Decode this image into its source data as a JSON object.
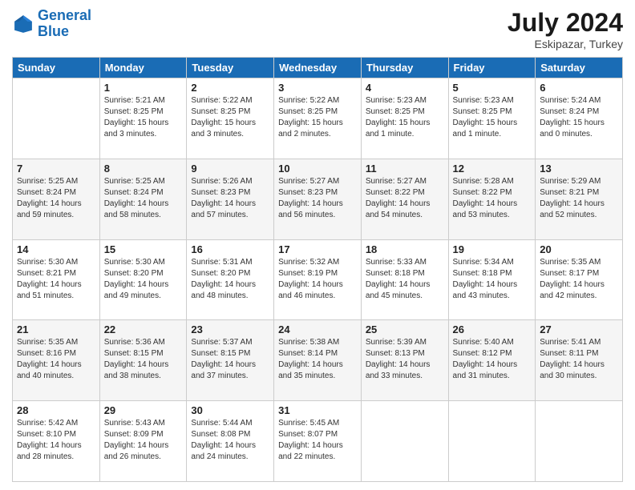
{
  "header": {
    "logo_line1": "General",
    "logo_line2": "Blue",
    "month": "July 2024",
    "location": "Eskipazar, Turkey"
  },
  "days": [
    "Sunday",
    "Monday",
    "Tuesday",
    "Wednesday",
    "Thursday",
    "Friday",
    "Saturday"
  ],
  "weeks": [
    [
      {
        "date": "",
        "sunrise": "",
        "sunset": "",
        "daylight": ""
      },
      {
        "date": "1",
        "sunrise": "Sunrise: 5:21 AM",
        "sunset": "Sunset: 8:25 PM",
        "daylight": "Daylight: 15 hours and 3 minutes."
      },
      {
        "date": "2",
        "sunrise": "Sunrise: 5:22 AM",
        "sunset": "Sunset: 8:25 PM",
        "daylight": "Daylight: 15 hours and 3 minutes."
      },
      {
        "date": "3",
        "sunrise": "Sunrise: 5:22 AM",
        "sunset": "Sunset: 8:25 PM",
        "daylight": "Daylight: 15 hours and 2 minutes."
      },
      {
        "date": "4",
        "sunrise": "Sunrise: 5:23 AM",
        "sunset": "Sunset: 8:25 PM",
        "daylight": "Daylight: 15 hours and 1 minute."
      },
      {
        "date": "5",
        "sunrise": "Sunrise: 5:23 AM",
        "sunset": "Sunset: 8:25 PM",
        "daylight": "Daylight: 15 hours and 1 minute."
      },
      {
        "date": "6",
        "sunrise": "Sunrise: 5:24 AM",
        "sunset": "Sunset: 8:24 PM",
        "daylight": "Daylight: 15 hours and 0 minutes."
      }
    ],
    [
      {
        "date": "7",
        "sunrise": "Sunrise: 5:25 AM",
        "sunset": "Sunset: 8:24 PM",
        "daylight": "Daylight: 14 hours and 59 minutes."
      },
      {
        "date": "8",
        "sunrise": "Sunrise: 5:25 AM",
        "sunset": "Sunset: 8:24 PM",
        "daylight": "Daylight: 14 hours and 58 minutes."
      },
      {
        "date": "9",
        "sunrise": "Sunrise: 5:26 AM",
        "sunset": "Sunset: 8:23 PM",
        "daylight": "Daylight: 14 hours and 57 minutes."
      },
      {
        "date": "10",
        "sunrise": "Sunrise: 5:27 AM",
        "sunset": "Sunset: 8:23 PM",
        "daylight": "Daylight: 14 hours and 56 minutes."
      },
      {
        "date": "11",
        "sunrise": "Sunrise: 5:27 AM",
        "sunset": "Sunset: 8:22 PM",
        "daylight": "Daylight: 14 hours and 54 minutes."
      },
      {
        "date": "12",
        "sunrise": "Sunrise: 5:28 AM",
        "sunset": "Sunset: 8:22 PM",
        "daylight": "Daylight: 14 hours and 53 minutes."
      },
      {
        "date": "13",
        "sunrise": "Sunrise: 5:29 AM",
        "sunset": "Sunset: 8:21 PM",
        "daylight": "Daylight: 14 hours and 52 minutes."
      }
    ],
    [
      {
        "date": "14",
        "sunrise": "Sunrise: 5:30 AM",
        "sunset": "Sunset: 8:21 PM",
        "daylight": "Daylight: 14 hours and 51 minutes."
      },
      {
        "date": "15",
        "sunrise": "Sunrise: 5:30 AM",
        "sunset": "Sunset: 8:20 PM",
        "daylight": "Daylight: 14 hours and 49 minutes."
      },
      {
        "date": "16",
        "sunrise": "Sunrise: 5:31 AM",
        "sunset": "Sunset: 8:20 PM",
        "daylight": "Daylight: 14 hours and 48 minutes."
      },
      {
        "date": "17",
        "sunrise": "Sunrise: 5:32 AM",
        "sunset": "Sunset: 8:19 PM",
        "daylight": "Daylight: 14 hours and 46 minutes."
      },
      {
        "date": "18",
        "sunrise": "Sunrise: 5:33 AM",
        "sunset": "Sunset: 8:18 PM",
        "daylight": "Daylight: 14 hours and 45 minutes."
      },
      {
        "date": "19",
        "sunrise": "Sunrise: 5:34 AM",
        "sunset": "Sunset: 8:18 PM",
        "daylight": "Daylight: 14 hours and 43 minutes."
      },
      {
        "date": "20",
        "sunrise": "Sunrise: 5:35 AM",
        "sunset": "Sunset: 8:17 PM",
        "daylight": "Daylight: 14 hours and 42 minutes."
      }
    ],
    [
      {
        "date": "21",
        "sunrise": "Sunrise: 5:35 AM",
        "sunset": "Sunset: 8:16 PM",
        "daylight": "Daylight: 14 hours and 40 minutes."
      },
      {
        "date": "22",
        "sunrise": "Sunrise: 5:36 AM",
        "sunset": "Sunset: 8:15 PM",
        "daylight": "Daylight: 14 hours and 38 minutes."
      },
      {
        "date": "23",
        "sunrise": "Sunrise: 5:37 AM",
        "sunset": "Sunset: 8:15 PM",
        "daylight": "Daylight: 14 hours and 37 minutes."
      },
      {
        "date": "24",
        "sunrise": "Sunrise: 5:38 AM",
        "sunset": "Sunset: 8:14 PM",
        "daylight": "Daylight: 14 hours and 35 minutes."
      },
      {
        "date": "25",
        "sunrise": "Sunrise: 5:39 AM",
        "sunset": "Sunset: 8:13 PM",
        "daylight": "Daylight: 14 hours and 33 minutes."
      },
      {
        "date": "26",
        "sunrise": "Sunrise: 5:40 AM",
        "sunset": "Sunset: 8:12 PM",
        "daylight": "Daylight: 14 hours and 31 minutes."
      },
      {
        "date": "27",
        "sunrise": "Sunrise: 5:41 AM",
        "sunset": "Sunset: 8:11 PM",
        "daylight": "Daylight: 14 hours and 30 minutes."
      }
    ],
    [
      {
        "date": "28",
        "sunrise": "Sunrise: 5:42 AM",
        "sunset": "Sunset: 8:10 PM",
        "daylight": "Daylight: 14 hours and 28 minutes."
      },
      {
        "date": "29",
        "sunrise": "Sunrise: 5:43 AM",
        "sunset": "Sunset: 8:09 PM",
        "daylight": "Daylight: 14 hours and 26 minutes."
      },
      {
        "date": "30",
        "sunrise": "Sunrise: 5:44 AM",
        "sunset": "Sunset: 8:08 PM",
        "daylight": "Daylight: 14 hours and 24 minutes."
      },
      {
        "date": "31",
        "sunrise": "Sunrise: 5:45 AM",
        "sunset": "Sunset: 8:07 PM",
        "daylight": "Daylight: 14 hours and 22 minutes."
      },
      {
        "date": "",
        "sunrise": "",
        "sunset": "",
        "daylight": ""
      },
      {
        "date": "",
        "sunrise": "",
        "sunset": "",
        "daylight": ""
      },
      {
        "date": "",
        "sunrise": "",
        "sunset": "",
        "daylight": ""
      }
    ]
  ]
}
